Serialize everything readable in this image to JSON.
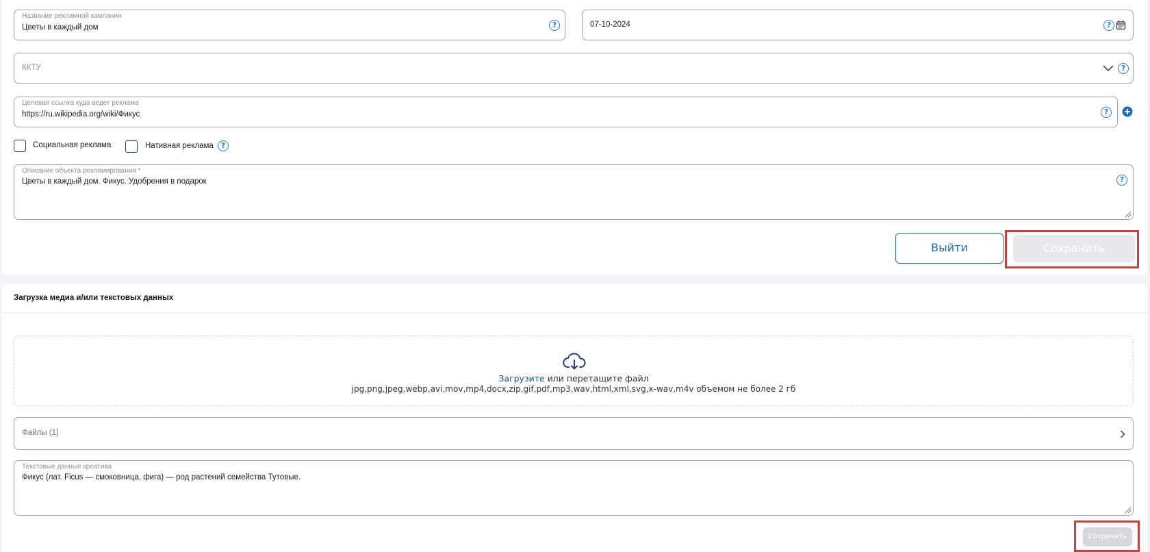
{
  "form": {
    "campaign_name": {
      "label": "Название рекламной кампании",
      "value": "Цветы в каждый дом"
    },
    "date": {
      "value": "07-10-2024"
    },
    "kktu": {
      "placeholder": "ККТУ"
    },
    "target_link": {
      "label": "Целевая ссылка куда ведет реклама",
      "value": "https://ru.wikipedia.org/wiki/Фикус"
    },
    "social_ad": {
      "label": "Социальная реклама",
      "checked": false
    },
    "native_ad": {
      "label": "Нативная реклама",
      "checked": false
    },
    "description": {
      "label": "Описание объекта рекламирования *",
      "value": "Цветы в каждый дом. Фикус. Удобрения в подарок"
    },
    "help_glyph": "?",
    "exit_label": "Выйти",
    "save_label": "Сохранить"
  },
  "media": {
    "title": "Загрузка медиа и/или текстовых данных",
    "upload_link": "Загрузите",
    "upload_text": " или перетащите файл",
    "formats_text": "jpg,png,jpeg,webp,avi,mov,mp4,docx,zip,gif,pdf,mp3,wav,html,xml,svg,x-wav,m4v объемом не более 2 гб",
    "files_label": "Файлы (1)",
    "creative_text": {
      "label": "Текстовые данные креатива",
      "value": "Фикус (лат. Ficus — смоковница, фига) — род растений семейства Тутовые."
    },
    "save_label": "Сохранить"
  },
  "colors": {
    "accent": "#1f7fd1",
    "highlight": "#c8403a",
    "disabled_button": "#e8e9ec"
  },
  "icons": [
    "help-icon",
    "calendar-icon",
    "chevron-down-icon",
    "plus-circle-icon",
    "cloud-download-icon",
    "chevron-right-icon"
  ]
}
